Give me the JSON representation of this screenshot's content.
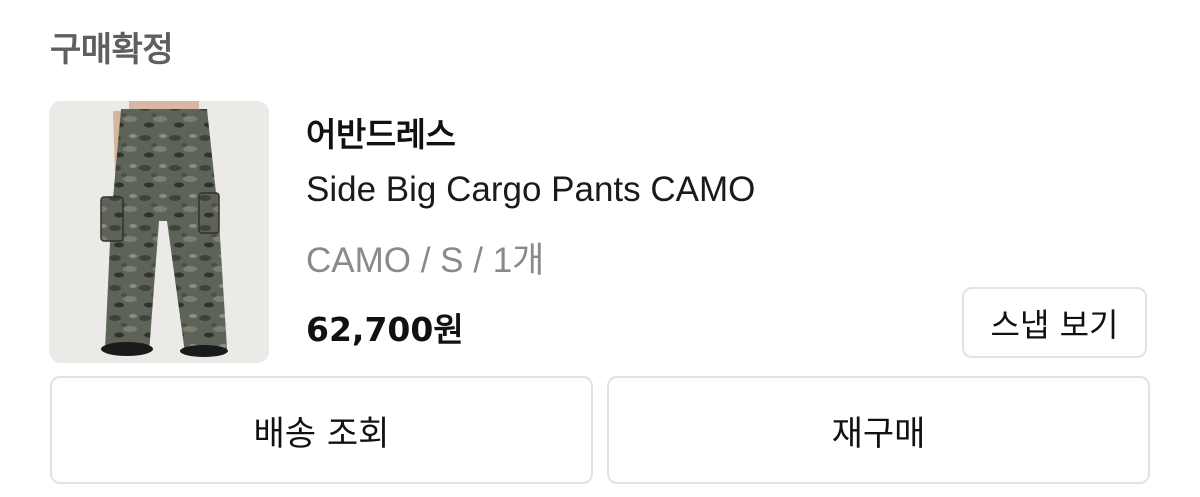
{
  "order": {
    "status": "구매확정"
  },
  "product": {
    "brand": "어반드레스",
    "name": "Side Big Cargo Pants CAMO",
    "option": "CAMO / S / 1개",
    "price": "62,700원",
    "image_subject": "camo-cargo-pants-photo"
  },
  "actions": {
    "snap_label": "스냅 보기",
    "delivery_label": "배송 조회",
    "repurchase_label": "재구매"
  }
}
